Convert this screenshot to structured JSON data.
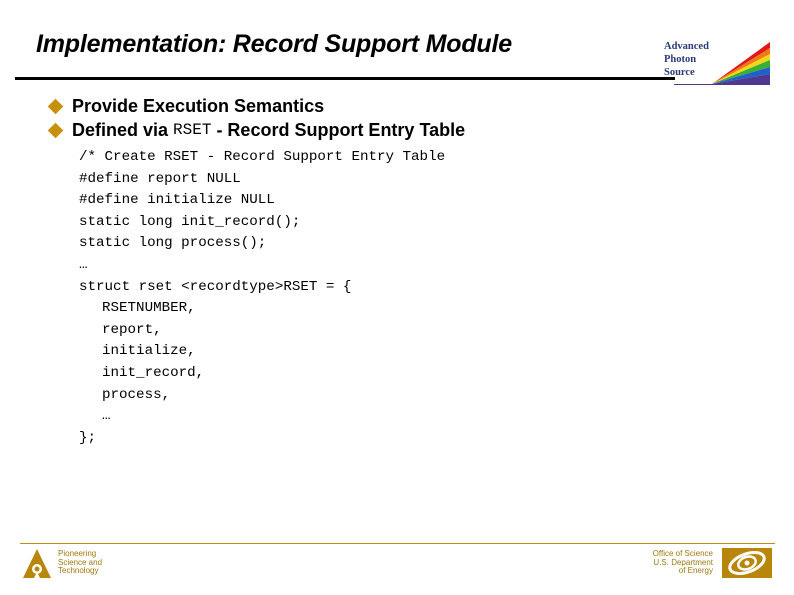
{
  "slide": {
    "title": "Implementation: Record Support Module",
    "bullets": [
      {
        "before": "Provide Execution Semantics",
        "code": "",
        "after": ""
      },
      {
        "before": "Defined via",
        "code": "RSET",
        "after": "- Record Support Entry Table"
      }
    ],
    "code_lines": [
      {
        "text": "/* Create RSET - Record Support Entry Table",
        "indent": false
      },
      {
        "text": "#define report NULL",
        "indent": false
      },
      {
        "text": "#define initialize NULL",
        "indent": false
      },
      {
        "text": "static long init_record();",
        "indent": false
      },
      {
        "text": "static long process();",
        "indent": false
      },
      {
        "text": "…",
        "indent": false
      },
      {
        "text": "struct rset <recordtype>RSET = {",
        "indent": false
      },
      {
        "text": "RSETNUMBER,",
        "indent": true
      },
      {
        "text": "report,",
        "indent": true
      },
      {
        "text": "initialize,",
        "indent": true
      },
      {
        "text": "init_record,",
        "indent": true
      },
      {
        "text": "process,",
        "indent": true
      },
      {
        "text": "…",
        "indent": true
      },
      {
        "text": "};",
        "indent": false
      }
    ]
  },
  "logos": {
    "aps": {
      "line1": "Advanced",
      "line2": "Photon",
      "line3": "Source"
    },
    "footer_left": {
      "line1": "Pioneering",
      "line2": "Science and",
      "line3": "Technology"
    },
    "footer_right": {
      "line1": "Office of Science",
      "line2": "U.S. Department",
      "line3": "of Energy"
    }
  },
  "colors": {
    "bullet": "#c8900a",
    "footer": "#a07810",
    "aps_text": "#2a3a7a"
  }
}
